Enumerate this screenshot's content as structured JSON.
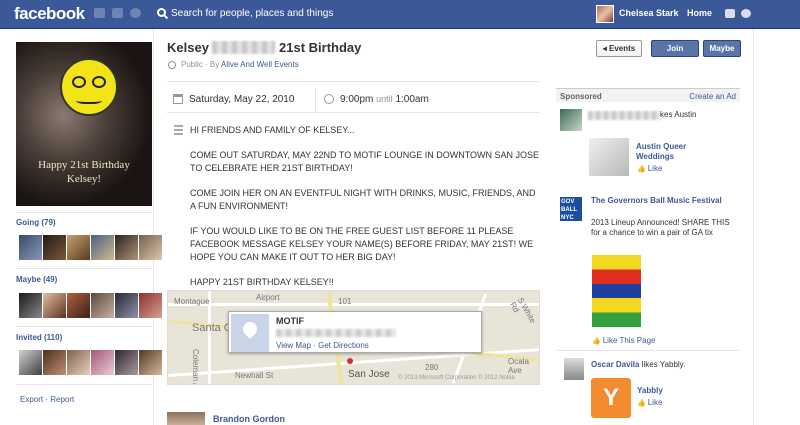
{
  "topbar": {
    "logo": "facebook",
    "search_placeholder": "Search for people, places and things",
    "user_name": "Chelsea Stark",
    "home_label": "Home"
  },
  "left": {
    "photo_caption_line1": "Happy 21st Birthday",
    "photo_caption_line2": "Kelsey!",
    "going_label": "Going (79)",
    "maybe_label": "Maybe (49)",
    "invited_label": "Invited (110)",
    "export_label": "Export",
    "link_sep": " · ",
    "report_label": "Report"
  },
  "event": {
    "title_prefix": "Kelsey",
    "title_suffix": "21st Birthday",
    "privacy": "Public",
    "by_prefix": " · By ",
    "host": "Alive And Well Events",
    "date": "Saturday, May 22, 2010",
    "time_start": "9:00pm",
    "time_until": "until",
    "time_end": "1:00am",
    "description": [
      "HI FRIENDS AND FAMILY OF KELSEY...",
      "COME OUT SATURDAY, MAY 22ND TO MOTIF LOUNGE IN DOWNTOWN SAN JOSE TO CELEBRATE HER 21ST BIRTHDAY!",
      "COME JOIN HER ON AN EVENTFUL NIGHT WITH DRINKS, MUSIC, FRIENDS, AND A FUN ENVIRONMENT!",
      "IF YOU WOULD LIKE TO BE ON THE FREE GUEST LIST BEFORE 11 PLEASE FACEBOOK MESSAGE KELSEY YOUR NAME(S) BEFORE FRIDAY, MAY 21ST! WE HOPE YOU CAN MAKE IT OUT TO HER BIG DAY!",
      "HAPPY 21ST BIRTHDAY KELSEY!!"
    ]
  },
  "buttons": {
    "events": "◂ Events",
    "join": "Join",
    "maybe": "Maybe"
  },
  "map": {
    "venue": "MOTIF",
    "view_map": "View Map",
    "link_sep": " · ",
    "get_directions": "Get Directions",
    "labels": {
      "santa_clara": "Santa C",
      "san_jose": "San Jose",
      "airport": "Airport",
      "montague": "Montague",
      "coleman": "Coleman Ave",
      "newhall": "Newhall St",
      "hwy101": "101",
      "white_rd": "S White Rd",
      "ocala": "Ocala Ave",
      "hwy280": "280"
    },
    "copyright": "© 2013 Microsoft Corporation © 2012 Nokia"
  },
  "post": {
    "author": "Brandon Gordon"
  },
  "right": {
    "sponsored_label": "Sponsored",
    "create_ad": "Create an Ad",
    "ad1_text": "kes Austin",
    "ad1_title": "Austin Queer Weddings",
    "ad2_title": "The Governors Ball Music Festival",
    "ad2_body": "2013 Lineup Announced! SHARE THIS for a chance to win a pair of GA tix",
    "ad2_logo": "GOV BALL NYC",
    "ad3_name": "Oscar Davila",
    "ad3_likes": "likes Yabbly.",
    "ad3_title": "Yabbly",
    "like": "Like",
    "like_page": "Like This Page"
  }
}
